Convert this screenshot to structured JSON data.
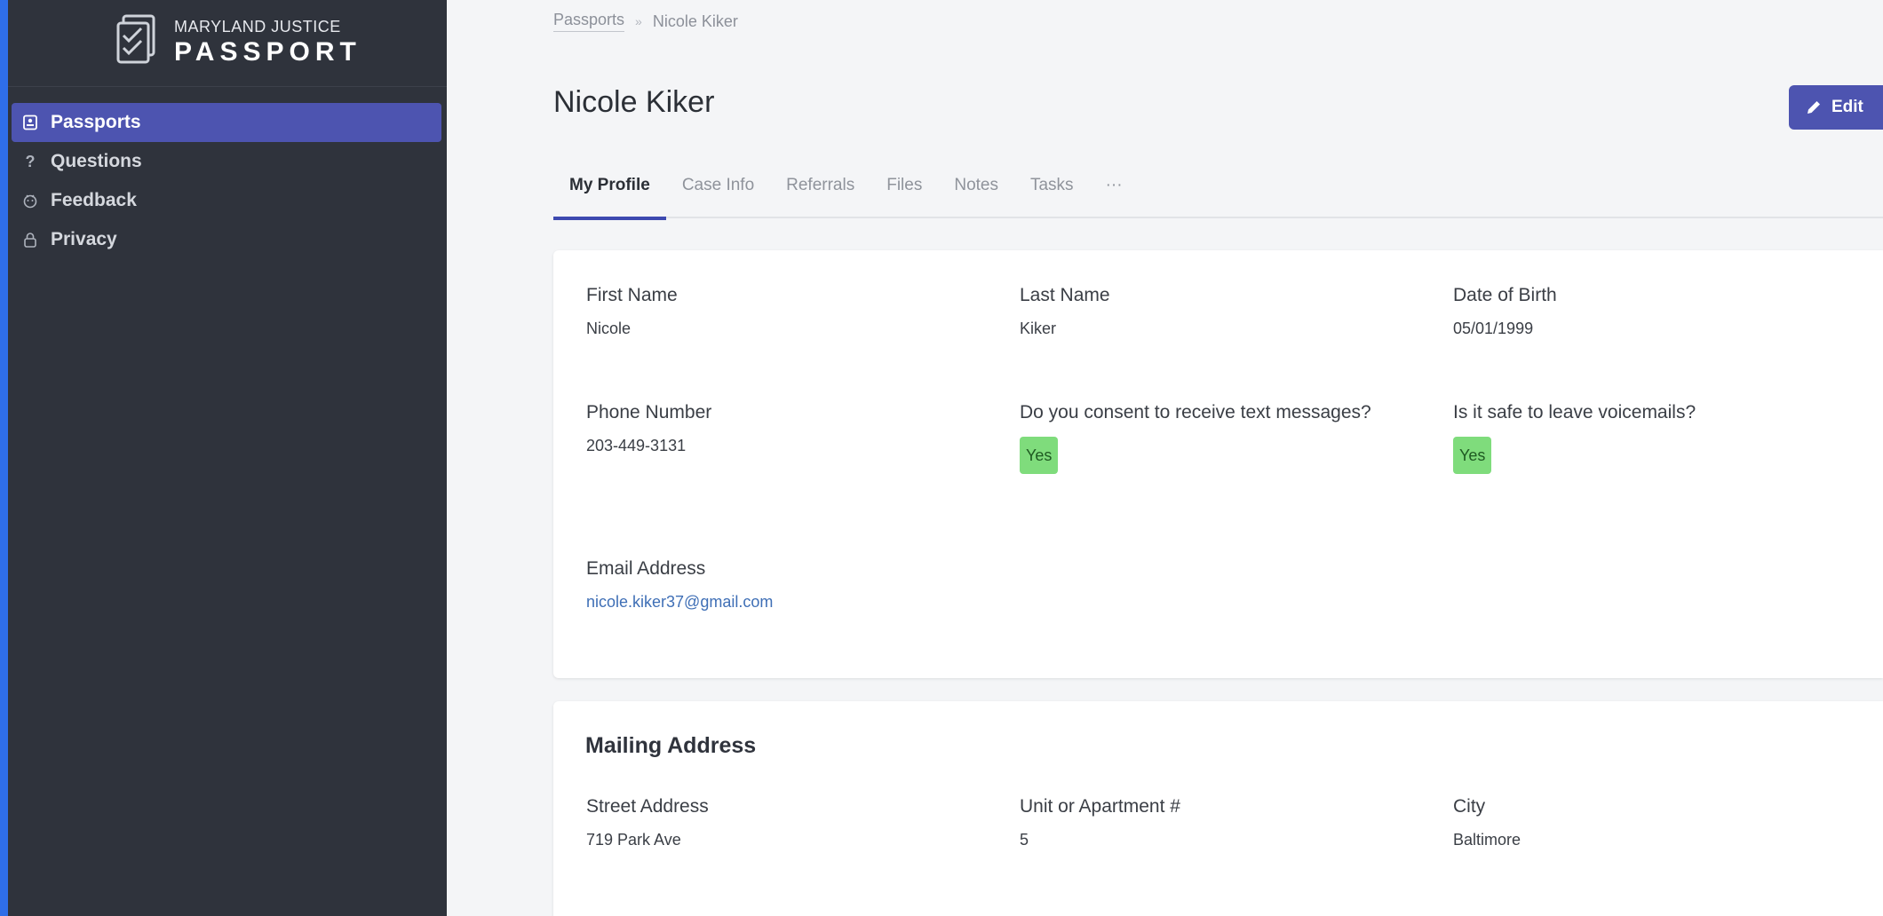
{
  "brand": {
    "line1": "MARYLAND JUSTICE",
    "line2": "PASSPORT"
  },
  "sidebar": {
    "items": [
      {
        "label": "Passports",
        "icon": "id-card-icon",
        "active": true
      },
      {
        "label": "Questions",
        "icon": "question-icon",
        "active": false
      },
      {
        "label": "Feedback",
        "icon": "feedback-icon",
        "active": false
      },
      {
        "label": "Privacy",
        "icon": "lock-icon",
        "active": false
      }
    ]
  },
  "breadcrumb": {
    "root": "Passports",
    "separator": "»",
    "current": "Nicole Kiker"
  },
  "page": {
    "title": "Nicole Kiker",
    "edit_label": "Edit"
  },
  "tabs": [
    {
      "label": "My Profile",
      "active": true
    },
    {
      "label": "Case Info",
      "active": false
    },
    {
      "label": "Referrals",
      "active": false
    },
    {
      "label": "Files",
      "active": false
    },
    {
      "label": "Notes",
      "active": false
    },
    {
      "label": "Tasks",
      "active": false
    },
    {
      "label": "···",
      "active": false
    }
  ],
  "profile": {
    "first_name": {
      "label": "First Name",
      "value": "Nicole"
    },
    "last_name": {
      "label": "Last Name",
      "value": "Kiker"
    },
    "dob": {
      "label": "Date of Birth",
      "value": "05/01/1999"
    },
    "phone": {
      "label": "Phone Number",
      "value": "203-449-3131"
    },
    "text_consent": {
      "label": "Do you consent to receive text messages?",
      "value": "Yes"
    },
    "voicemail_safe": {
      "label": "Is it safe to leave voicemails?",
      "value": "Yes"
    },
    "email": {
      "label": "Email Address",
      "value": "nicole.kiker37@gmail.com"
    }
  },
  "mailing": {
    "title": "Mailing Address",
    "street": {
      "label": "Street Address",
      "value": "719 Park Ave"
    },
    "unit": {
      "label": "Unit or Apartment #",
      "value": "5"
    },
    "city": {
      "label": "City",
      "value": "Baltimore"
    }
  },
  "colors": {
    "sidebar_bg": "#2f333c",
    "accent": "#4d54b0",
    "left_edge": "#2f6ee8",
    "badge_green": "#7fdc7c",
    "link": "#3f6fb6"
  }
}
